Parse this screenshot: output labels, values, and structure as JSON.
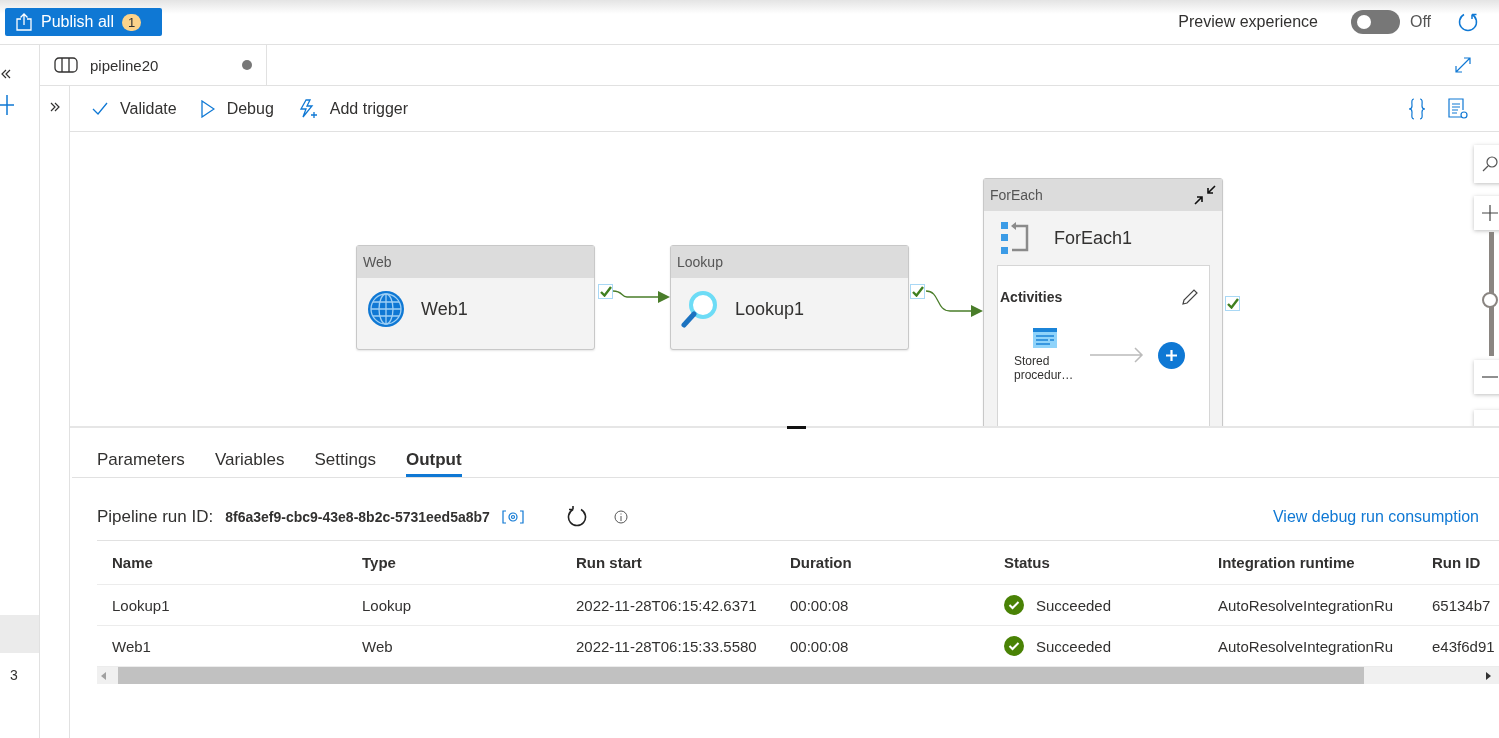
{
  "header": {
    "publish": {
      "label": "Publish all",
      "badge": "1"
    },
    "preview": {
      "label": "Preview experience",
      "on": false,
      "state_label": "Off"
    }
  },
  "rail": {
    "count": "3"
  },
  "document_tab": {
    "title": "pipeline20",
    "unsaved": true
  },
  "toolbar": [
    {
      "kind": "validate",
      "label": "Validate"
    },
    {
      "kind": "debug",
      "label": "Debug"
    },
    {
      "kind": "trigger",
      "label": "Add trigger"
    }
  ],
  "activities": [
    {
      "kind": "web",
      "type": "Web",
      "name": "Web1"
    },
    {
      "kind": "lookup",
      "type": "Lookup",
      "name": "Lookup1"
    },
    {
      "kind": "foreach",
      "type": "ForEach",
      "name": "ForEach1",
      "inner": {
        "title": "Activities",
        "items": [
          {
            "kind": "stored_procedure",
            "name": "Stored procedur…"
          }
        ]
      }
    }
  ],
  "zoom": {
    "level": 0.45
  },
  "panel": {
    "tabs": [
      {
        "label": "Parameters",
        "selected": false
      },
      {
        "label": "Variables",
        "selected": false
      },
      {
        "label": "Settings",
        "selected": false
      },
      {
        "label": "Output",
        "selected": true
      }
    ],
    "run_id_label": "Pipeline run ID:",
    "run_id": "8f6a3ef9-cbc9-43e8-8b2c-5731eed5a8b7",
    "consumption_link": "View debug run consumption",
    "table": {
      "columns": [
        "Name",
        "Type",
        "Run start",
        "Duration",
        "Status",
        "Integration runtime",
        "Run ID"
      ],
      "rows": [
        {
          "name": "Lookup1",
          "type": "Lookup",
          "run_start": "2022-11-28T06:15:42.6371",
          "duration": "00:00:08",
          "status": {
            "kind": "succeeded",
            "label": "Succeeded"
          },
          "integration_runtime": "AutoResolveIntegrationRu",
          "run_id": "65134b7"
        },
        {
          "name": "Web1",
          "type": "Web",
          "run_start": "2022-11-28T06:15:33.5580",
          "duration": "00:00:08",
          "status": {
            "kind": "succeeded",
            "label": "Succeeded"
          },
          "integration_runtime": "AutoResolveIntegrationRu",
          "run_id": "e43f6d91"
        }
      ]
    }
  }
}
